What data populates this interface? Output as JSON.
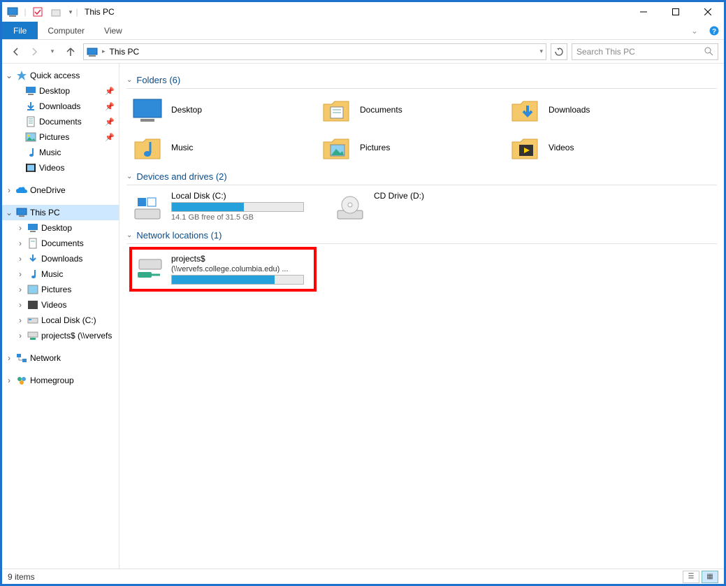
{
  "window": {
    "title": "This PC"
  },
  "ribbon": {
    "file": "File",
    "tabs": [
      "Computer",
      "View"
    ]
  },
  "nav": {
    "address_crumb": "This PC",
    "search_placeholder": "Search This PC"
  },
  "tree": {
    "quick_access": "Quick access",
    "quick_items": [
      {
        "label": "Desktop",
        "pinned": true
      },
      {
        "label": "Downloads",
        "pinned": true
      },
      {
        "label": "Documents",
        "pinned": true
      },
      {
        "label": "Pictures",
        "pinned": true
      },
      {
        "label": "Music",
        "pinned": false
      },
      {
        "label": "Videos",
        "pinned": false
      }
    ],
    "onedrive": "OneDrive",
    "this_pc": "This PC",
    "pc_items": [
      "Desktop",
      "Documents",
      "Downloads",
      "Music",
      "Pictures",
      "Videos",
      "Local Disk (C:)",
      "projects$ (\\\\vervefs"
    ],
    "network": "Network",
    "homegroup": "Homegroup"
  },
  "sections": {
    "folders": {
      "title": "Folders (6)",
      "items": [
        "Desktop",
        "Documents",
        "Downloads",
        "Music",
        "Pictures",
        "Videos"
      ]
    },
    "drives": {
      "title": "Devices and drives (2)",
      "local": {
        "name": "Local Disk (C:)",
        "free_text": "14.1 GB free of 31.5 GB",
        "fill_pct": 55
      },
      "cd": {
        "name": "CD Drive (D:)"
      }
    },
    "network": {
      "title": "Network locations (1)",
      "item": {
        "name": "projects$",
        "sub": "(\\\\vervefs.college.columbia.edu) ...",
        "fill_pct": 78
      }
    }
  },
  "status": {
    "text": "9 items"
  }
}
